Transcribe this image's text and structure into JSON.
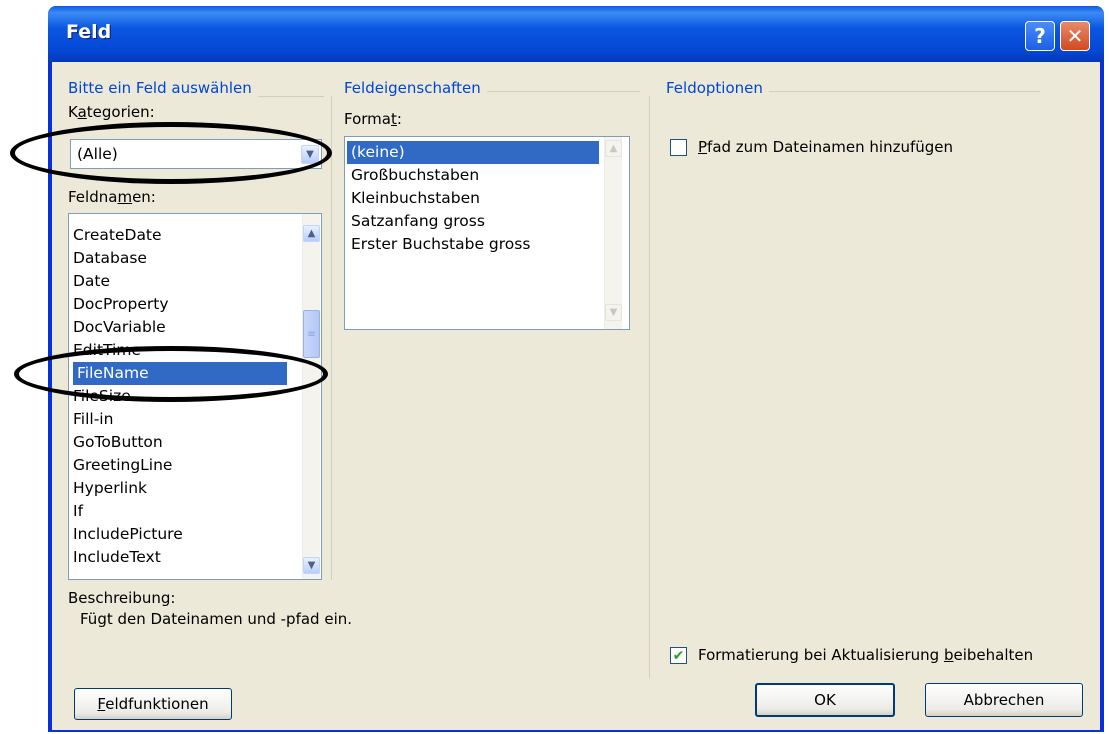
{
  "window": {
    "title": "Feld"
  },
  "titlebar_buttons": {
    "help_label": "?",
    "close_label": "✕"
  },
  "left_group": {
    "header": "Bitte ein Feld auswählen",
    "categories_label": {
      "pre": "K",
      "accel": "a",
      "post": "tegorien:"
    },
    "category_value": "(Alle)",
    "fieldnames_label": {
      "pre": "Feldna",
      "accel": "m",
      "post": "en:"
    },
    "fieldnames": [
      "CreateDate",
      "Database",
      "Date",
      "DocProperty",
      "DocVariable",
      "EditTime",
      "FileName",
      "FileSize",
      "Fill-in",
      "GoToButton",
      "GreetingLine",
      "Hyperlink",
      "If",
      "IncludePicture",
      "IncludeText"
    ],
    "selected_field": "FileName",
    "description_label": "Beschreibung:",
    "description_text": "Fügt den Dateinamen und -pfad ein."
  },
  "middle_group": {
    "header": "Feldeigenschaften",
    "format_label": {
      "pre": "Forma",
      "accel": "t",
      "post": ":"
    },
    "formats": [
      "(keine)",
      "Großbuchstaben",
      "Kleinbuchstaben",
      "Satzanfang gross",
      "Erster Buchstabe gross"
    ],
    "selected_format": "(keine)"
  },
  "right_group": {
    "header": "Feldoptionen",
    "path_option": {
      "pre": "",
      "accel": "P",
      "post": "fad zum Dateinamen hinzufügen",
      "checked": false
    },
    "preserve_option": {
      "pre": "Formatierung bei Aktualisierung ",
      "accel": "b",
      "post": "eibehalten",
      "checked": true
    }
  },
  "buttons": {
    "field_codes": {
      "pre": "",
      "accel": "F",
      "post": "eldfunktionen"
    },
    "ok": "OK",
    "cancel": "Abbrechen"
  },
  "icons": {
    "scroll_up": "▲",
    "scroll_down": "▼",
    "combo_arrow": "▼",
    "checkmark": "✔",
    "thumb_grip": "≡"
  },
  "colors": {
    "titlebar": "#0a56e0",
    "dialog_bg": "#ece9d8",
    "group_header": "#0046d5",
    "selection": "#316ac5",
    "annotation": "#000000"
  }
}
